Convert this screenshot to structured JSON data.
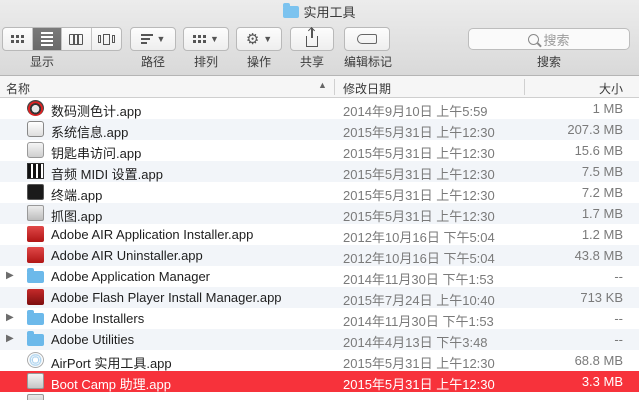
{
  "window": {
    "title": "实用工具"
  },
  "toolbar": {
    "view_label": "显示",
    "arrange_label": "路径",
    "sort_label": "排列",
    "action_label": "操作",
    "share_label": "共享",
    "tag_label": "编辑标记",
    "search_placeholder": "搜索",
    "search_label": "搜索"
  },
  "columns": {
    "name": "名称",
    "date": "修改日期",
    "size": "大小"
  },
  "files": [
    {
      "name": "数码测色计.app",
      "date": "2014年9月10日 上午5:59",
      "size": "1 MB",
      "icon": "app-gauge",
      "folder": false
    },
    {
      "name": "系统信息.app",
      "date": "2015年5月31日 上午12:30",
      "size": "207.3 MB",
      "icon": "app-sysinfo",
      "folder": false
    },
    {
      "name": "钥匙串访问.app",
      "date": "2015年5月31日 上午12:30",
      "size": "15.6 MB",
      "icon": "app-keychain",
      "folder": false
    },
    {
      "name": "音频 MIDI 设置.app",
      "date": "2015年5月31日 上午12:30",
      "size": "7.5 MB",
      "icon": "app-midi",
      "folder": false
    },
    {
      "name": "终端.app",
      "date": "2015年5月31日 上午12:30",
      "size": "7.2 MB",
      "icon": "app-term",
      "folder": false
    },
    {
      "name": "抓图.app",
      "date": "2015年5月31日 上午12:30",
      "size": "1.7 MB",
      "icon": "app-grab",
      "folder": false
    },
    {
      "name": "Adobe AIR Application Installer.app",
      "date": "2012年10月16日 下午5:04",
      "size": "1.2 MB",
      "icon": "app-adobe",
      "folder": false
    },
    {
      "name": "Adobe AIR Uninstaller.app",
      "date": "2012年10月16日 下午5:04",
      "size": "43.8 MB",
      "icon": "app-adobe",
      "folder": false
    },
    {
      "name": "Adobe Application Manager",
      "date": "2014年11月30日 下午1:53",
      "size": "--",
      "icon": "folder",
      "folder": true
    },
    {
      "name": "Adobe Flash Player Install Manager.app",
      "date": "2015年7月24日 上午10:40",
      "size": "713 KB",
      "icon": "app-flash",
      "folder": false
    },
    {
      "name": "Adobe Installers",
      "date": "2014年11月30日 下午1:53",
      "size": "--",
      "icon": "folder",
      "folder": true
    },
    {
      "name": "Adobe Utilities",
      "date": "2014年4月13日 下午3:48",
      "size": "--",
      "icon": "folder",
      "folder": true
    },
    {
      "name": "AirPort 实用工具.app",
      "date": "2015年5月31日 上午12:30",
      "size": "68.8 MB",
      "icon": "app-airport",
      "folder": false
    },
    {
      "name": "Boot Camp 助理.app",
      "date": "2015年5月31日 上午12:30",
      "size": "3.3 MB",
      "icon": "app-bootcamp",
      "folder": false,
      "selected": true
    },
    {
      "name": "",
      "date": "",
      "size": "",
      "icon": "app-generic",
      "folder": false
    }
  ],
  "colors": {
    "selection": "#f7323b",
    "alt_row": "#f2f5f9",
    "folder": "#6cb9ea"
  }
}
